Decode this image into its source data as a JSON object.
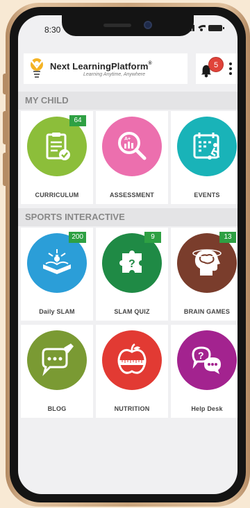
{
  "status_bar": {
    "time": "8:30"
  },
  "app_bar": {
    "brand_name": "Next LearningPlatform",
    "brand_mark": "®",
    "tagline": "Learning Anytime, Anywhere",
    "notification_count": "5"
  },
  "sections": [
    {
      "title": "MY CHILD",
      "tiles": [
        {
          "label": "CURRICULUM",
          "badge": "64",
          "color": "#8cbe3a",
          "icon": "clipboard-icon"
        },
        {
          "label": "ASSESSMENT",
          "badge": "",
          "color": "#ec6fae",
          "icon": "magnifier-chart-icon"
        },
        {
          "label": "EVENTS",
          "badge": "",
          "color": "#19b3b8",
          "icon": "calendar-player-icon"
        }
      ]
    },
    {
      "title": "SPORTS INTERACTIVE",
      "tiles": [
        {
          "label": "Daily SLAM",
          "badge": "200",
          "color": "#2b9ed8",
          "icon": "open-book-icon"
        },
        {
          "label": "SLAM QUIZ",
          "badge": "9",
          "color": "#1f8a45",
          "icon": "puzzle-question-icon"
        },
        {
          "label": "BRAIN GAMES",
          "badge": "13",
          "color": "#7a3d2c",
          "icon": "brain-head-icon"
        },
        {
          "label": "BLOG",
          "badge": "",
          "color": "#7a9a33",
          "icon": "speech-pen-icon"
        },
        {
          "label": "NUTRITION",
          "badge": "",
          "color": "#e23a33",
          "icon": "apple-tape-icon"
        },
        {
          "label": "Help Desk",
          "badge": "",
          "color": "#a3238f",
          "icon": "chat-question-icon"
        }
      ]
    }
  ],
  "colors": {
    "badge_green": "#2ea043",
    "notification_red": "#e0433a",
    "section_bg": "#e4e4e6"
  }
}
